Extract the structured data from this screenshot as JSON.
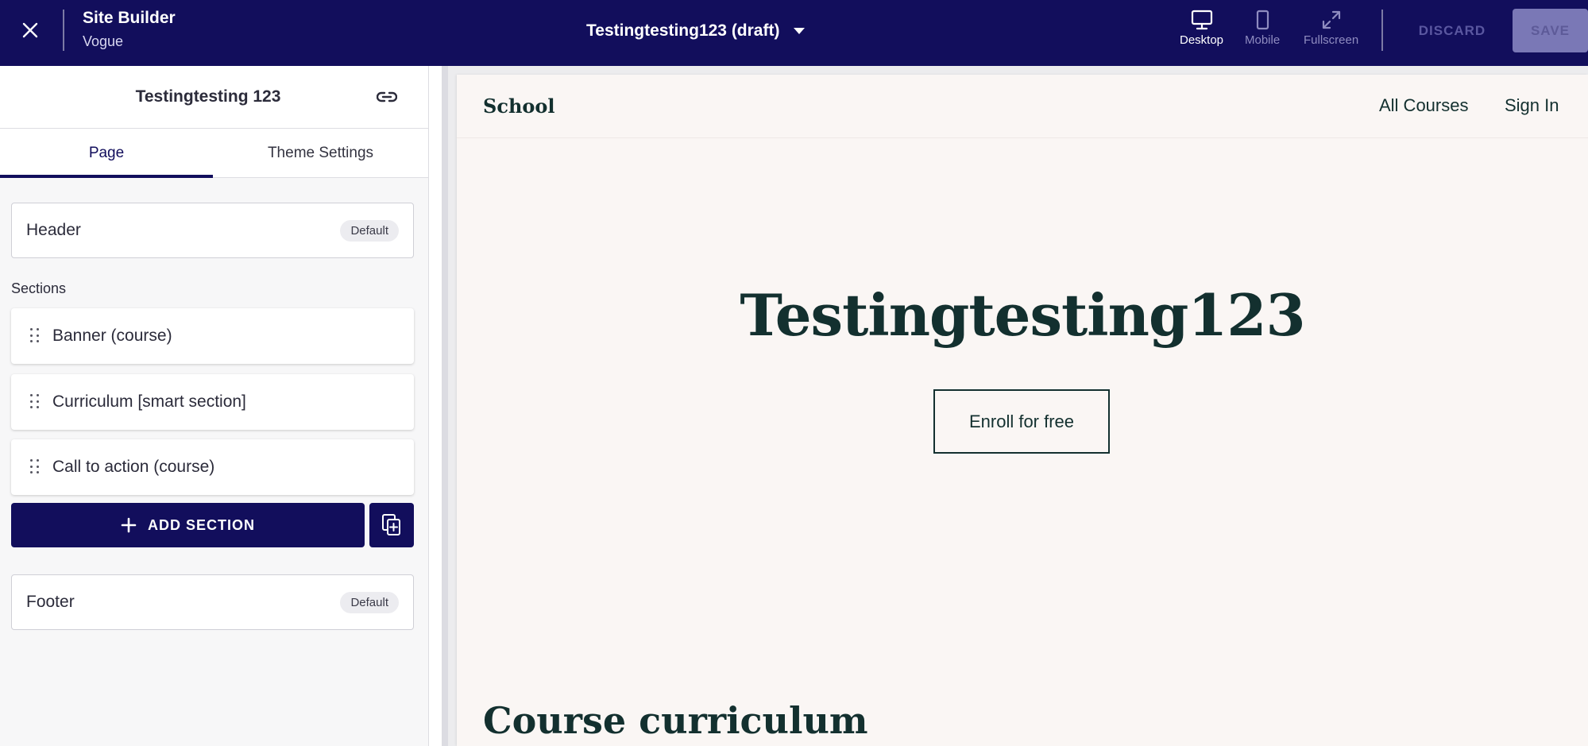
{
  "topbar": {
    "app_title": "Site Builder",
    "app_subtitle": "Vogue",
    "page_selector": "Testingtesting123 (draft)",
    "views": [
      {
        "label": "Desktop",
        "icon": "desktop-icon",
        "active": true
      },
      {
        "label": "Mobile",
        "icon": "mobile-icon",
        "active": false
      },
      {
        "label": "Fullscreen",
        "icon": "fullscreen-icon",
        "active": false
      }
    ],
    "discard_label": "DISCARD",
    "save_label": "SAVE"
  },
  "panel": {
    "title": "Testingtesting 123",
    "tabs": [
      {
        "label": "Page",
        "active": true
      },
      {
        "label": "Theme Settings",
        "active": false
      }
    ],
    "header": {
      "label": "Header",
      "badge": "Default"
    },
    "sections_label": "Sections",
    "sections": [
      {
        "label": "Banner (course)"
      },
      {
        "label": "Curriculum [smart section]"
      },
      {
        "label": "Call to action (course)"
      }
    ],
    "add_section_label": "ADD SECTION",
    "footer": {
      "label": "Footer",
      "badge": "Default"
    }
  },
  "preview": {
    "logo": "School",
    "nav_links": [
      "All Courses",
      "Sign In"
    ],
    "hero_title": "Testingtesting123",
    "cta_label": "Enroll for free",
    "curriculum_heading": "Course curriculum"
  },
  "colors": {
    "brand_navy": "#120e5c",
    "preview_text": "#13302f",
    "preview_bg": "#faf6f4"
  }
}
